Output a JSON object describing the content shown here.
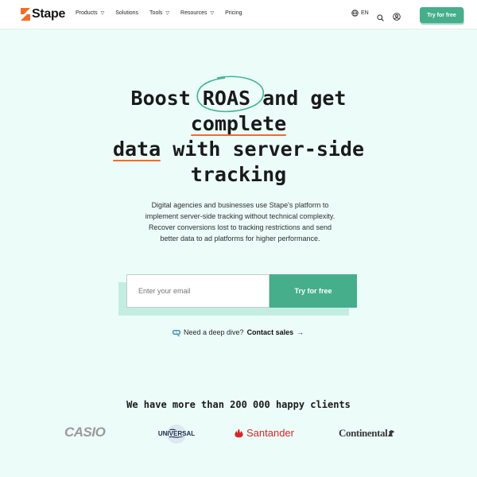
{
  "brand": {
    "name": "Stape",
    "accent": "#f26b2b",
    "primary": "#46ae8b"
  },
  "nav": {
    "items": [
      {
        "label": "Products",
        "has_dropdown": true
      },
      {
        "label": "Solutions",
        "has_dropdown": false
      },
      {
        "label": "Tools",
        "has_dropdown": true
      },
      {
        "label": "Resources",
        "has_dropdown": true
      },
      {
        "label": "Pricing",
        "has_dropdown": false
      }
    ],
    "caret": "▽",
    "language": "EN",
    "cta": "Try for free",
    "icons": [
      "globe-icon",
      "search-icon",
      "user-icon"
    ]
  },
  "hero": {
    "title_word1": "Boost",
    "title_roas": "ROAS",
    "title_rest1": "and get",
    "title_complete": "complete",
    "title_data": "data",
    "title_rest2": "with server-side",
    "title_tracking": "tracking",
    "description": "Digital agencies and businesses use Stape's platform to implement server-side tracking without technical complexity. Recover conversions lost to tracking restrictions and send better data to ad platforms for higher performance."
  },
  "form": {
    "email_placeholder": "Enter your email",
    "email_value": "",
    "submit_label": "Try for free"
  },
  "contact": {
    "prompt": "Need a deep dive?",
    "link": "Contact sales",
    "arrow": "→"
  },
  "clients": {
    "title": "We have more than 200 000 happy clients",
    "logos": [
      "CASIO",
      "UNIVERSAL",
      "Santander",
      "Continental"
    ]
  }
}
